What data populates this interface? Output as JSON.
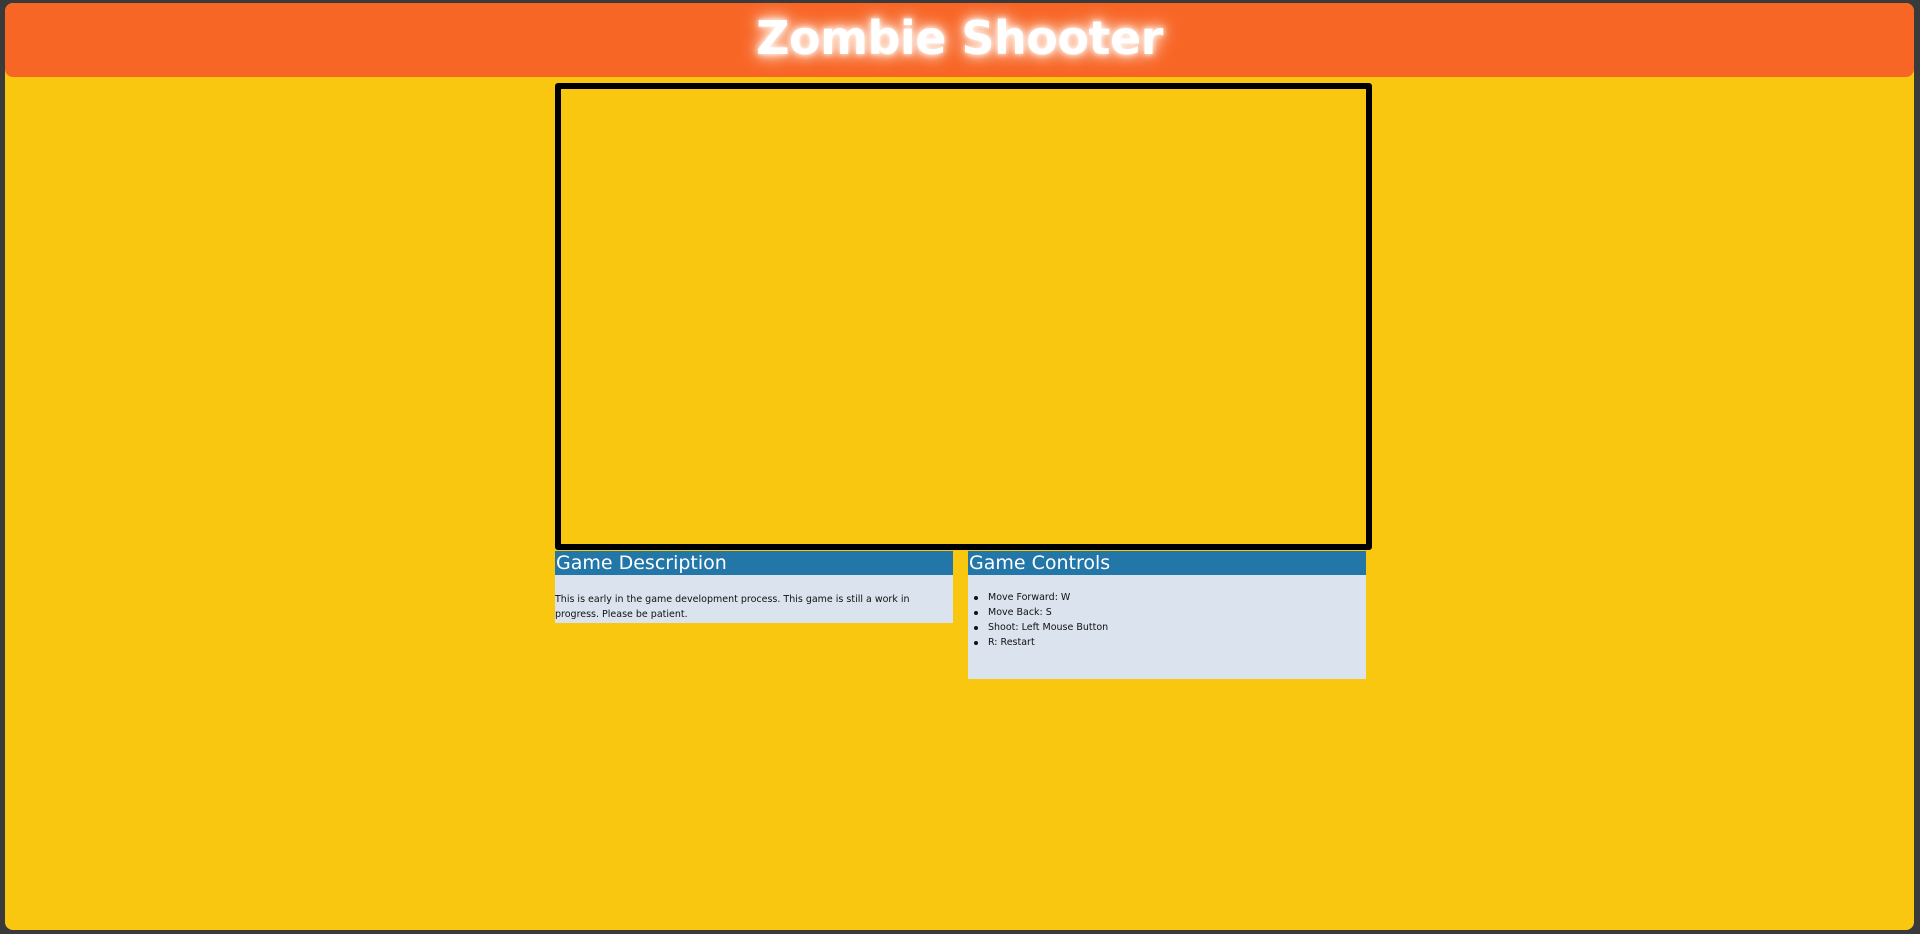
{
  "header": {
    "title": "Zombie Shooter"
  },
  "description": {
    "heading": "Game Description",
    "text": "This is early in the game development process. This game is still a work in progress. Please be patient."
  },
  "controls": {
    "heading": "Game Controls",
    "items": [
      "Move Forward: W",
      "Move Back: S",
      "Shoot: Left Mouse Button",
      "R: Restart"
    ]
  },
  "colors": {
    "background": "#f9c710",
    "header": "#f86626",
    "panel_heading": "#2276a8",
    "panel_body": "#dae3ee"
  }
}
